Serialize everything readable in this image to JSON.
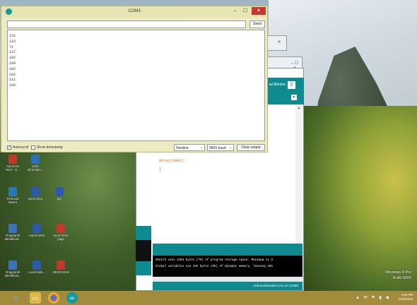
{
  "serial_monitor": {
    "title": "COM3",
    "send_label": "Send",
    "output_lines": [
      "121",
      "123",
      "71",
      "127",
      "102",
      "104",
      "102",
      "102",
      "111",
      "106"
    ],
    "autoscroll_label": "Autoscroll",
    "autoscroll_checked": true,
    "timestamp_label": "Show timestamp",
    "line_ending": "Newline",
    "baud": "9600 baud",
    "clear_label": "Clear output"
  },
  "ide": {
    "monitor_label": "ial Monitor",
    "code_line_1": "delay(1000);",
    "code_line_2": "}",
    "console_line_1": "Sketch uses 2304 bytes (7%) of program storage space. Maximum is 3",
    "console_line_2": "Global variables use 192 bytes (9%) of dynamic memory, leaving 185",
    "status_text": "Arduino/Genuino Uno on COM3"
  },
  "desktop_icons": [
    {
      "label": "AutoCAD 2017 - E...",
      "color": "#c0392b"
    },
    {
      "label": "Unit1 Informatio...",
      "color": "#2f6fb5"
    },
    {
      "label": "Find and Mount",
      "color": "#2a7ab0"
    },
    {
      "label": "word 2013",
      "color": "#2b5ba8"
    },
    {
      "label": "ppr",
      "color": "#2b5ba8"
    },
    {
      "label": "Fingerprint Identificati...",
      "color": "#3a73b8"
    },
    {
      "label": "report word",
      "color": "#2b5ba8"
    },
    {
      "label": "report front page",
      "color": "#c0392b"
    },
    {
      "label": "Fingerprint identificati...",
      "color": "#3a73b8"
    },
    {
      "label": "Local Disk...",
      "color": "#2b5ba8"
    },
    {
      "label": "1BIOS MAN",
      "color": "#c0392b"
    }
  ],
  "watermark": {
    "line1": "Windows 8 Pro",
    "line2": "Build 9200"
  },
  "clock": {
    "time": "8:43 PM",
    "date": "11/25/2016"
  },
  "taskbar": {
    "ie_icon": "ie-icon",
    "explorer_icon": "folder-icon",
    "chrome_icon": "chrome-icon",
    "arduino_icon": "arduino-icon"
  }
}
